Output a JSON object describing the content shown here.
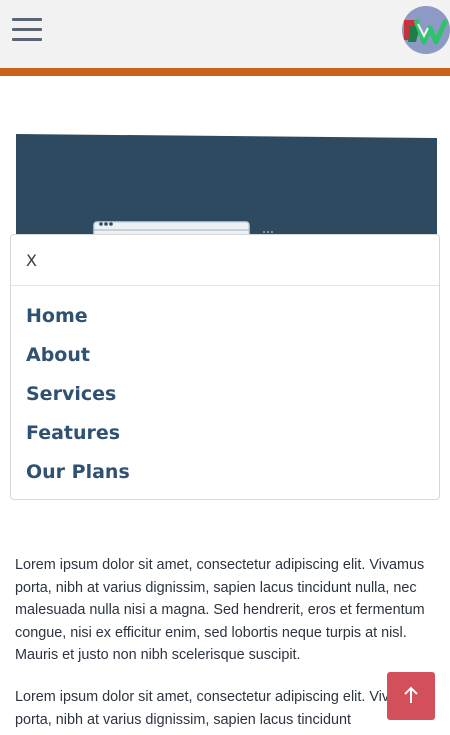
{
  "header": {
    "menu_icon": "hamburger-icon",
    "logo_icon": "brand-logo"
  },
  "hero": {
    "illustration_icon": "browser-window-illustration"
  },
  "nav_panel": {
    "close_label": "X",
    "items": [
      {
        "label": "Home"
      },
      {
        "label": "About"
      },
      {
        "label": "Services"
      },
      {
        "label": "Features"
      },
      {
        "label": "Our Plans"
      }
    ]
  },
  "content": {
    "paragraph_1": "Lorem ipsum dolor sit amet, consectetur adipiscing elit. Vivamus porta, nibh at varius dignissim, sapien lacus tincidunt nulla, nec malesuada nulla nisi a magna. Sed hendrerit, eros et fermentum congue, nisi ex efficitur enim, sed lobortis neque turpis at nisl. Mauris et justo non nibh scelerisque suscipit.",
    "paragraph_2": "Lorem ipsum dolor sit amet, consectetur adipiscing elit. Vivamus porta, nibh at varius dignissim, sapien lacus tincidunt"
  },
  "back_to_top": {
    "icon": "arrow-up-icon"
  },
  "colors": {
    "header_bg": "#f2f2f2",
    "accent_bar": "#c9621c",
    "hero_bg": "#2d4a61",
    "nav_text": "#2f5272",
    "to_top_button": "#d3505a"
  }
}
